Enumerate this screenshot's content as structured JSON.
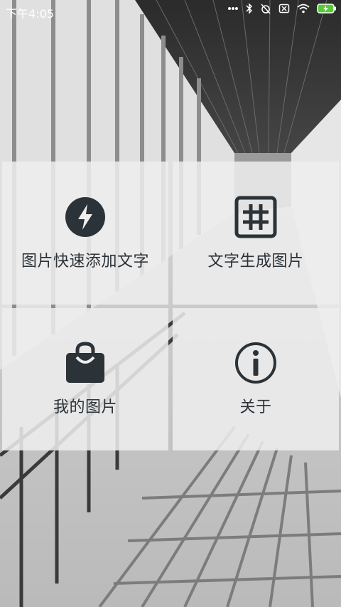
{
  "status_bar": {
    "time": "下午4:05",
    "icons": [
      "more-dots-icon",
      "bluetooth-icon",
      "alarm-off-icon",
      "sim-off-icon",
      "wifi-icon",
      "battery-charging-icon"
    ],
    "battery_color": "#55cc33"
  },
  "menu": {
    "items": [
      {
        "label": "图片快速添加文字",
        "icon": "lightning-icon"
      },
      {
        "label": "文字生成图片",
        "icon": "hash-grid-icon"
      },
      {
        "label": "我的图片",
        "icon": "bag-icon"
      },
      {
        "label": "关于",
        "icon": "info-icon"
      }
    ]
  },
  "colors": {
    "tile_bg": "#eeeeee",
    "icon_dark": "#2b3238"
  }
}
